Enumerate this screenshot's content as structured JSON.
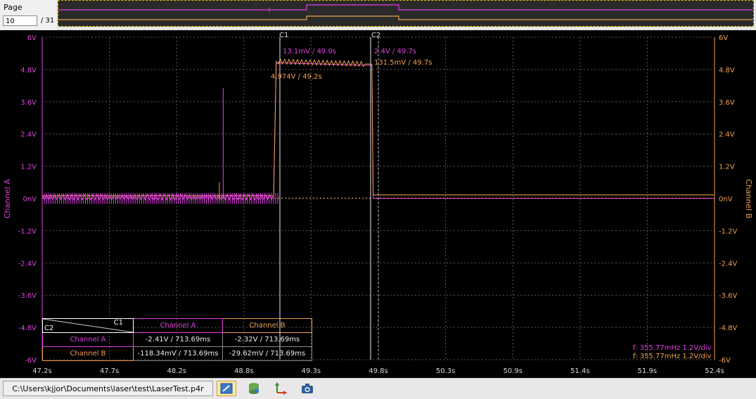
{
  "page": {
    "label": "Page",
    "current": "10",
    "total": "/ 31"
  },
  "colors": {
    "channel_a": "#e040e0",
    "channel_b": "#f0a050",
    "grid": "#5a5a5a",
    "background": "#000000"
  },
  "cursors": {
    "c1_label": "C1",
    "c2_label": "C2"
  },
  "annotations": {
    "c1_top": "13.1mV / 49.0s",
    "c1_mid": "4.974V / 49.2s",
    "c2_a": "2.4V / 49.7s",
    "c2_b": "131.5mV / 49.7s"
  },
  "axes": {
    "left_label": "Channel A",
    "right_label": "Channel B",
    "y_ticks": [
      "6V",
      "4.8V",
      "3.6V",
      "2.4V",
      "1.2V",
      "0nV",
      "-1.2V",
      "-2.4V",
      "-3.6V",
      "-4.8V",
      "-6V"
    ],
    "x_ticks": [
      "47.2s",
      "47.7s",
      "48.2s",
      "48.8s",
      "49.3s",
      "49.8s",
      "50.3s",
      "50.9s",
      "51.4s",
      "51.9s",
      "52.4s"
    ]
  },
  "measurement_table": {
    "corner_top": "C1",
    "corner_bottom": "C2",
    "headers": [
      "Channel A",
      "Channel B"
    ],
    "rows": [
      {
        "label": "Channel A",
        "cells": [
          "-2.41V / 713.69ms",
          "-2.32V / 713.69ms"
        ]
      },
      {
        "label": "Channel B",
        "cells": [
          "-118.34mV / 713.69ms",
          "-29.62mV / 713.69ms"
        ]
      }
    ]
  },
  "info": {
    "line_a": "f: 355.77mHz  1.2V/div",
    "line_b": "f: 355.77mHz  1.2V/div"
  },
  "chart_data": {
    "type": "line",
    "xlabel": "",
    "ylabel": "Channel A",
    "ylabel_right": "Channel B",
    "xlim": [
      47.2,
      52.4
    ],
    "ylim": [
      -6,
      6
    ],
    "grid": true,
    "series": [
      {
        "name": "Channel A",
        "x": [
          47.2,
          48.99,
          49.01,
          49.75,
          49.76,
          52.4
        ],
        "y": [
          0.0,
          0.0,
          5.05,
          4.95,
          0.0,
          0.0
        ]
      },
      {
        "name": "Channel B",
        "x": [
          47.2,
          48.99,
          49.01,
          49.75,
          49.76,
          52.4
        ],
        "y": [
          0.1,
          0.1,
          5.1,
          5.0,
          0.13,
          0.13
        ]
      }
    ],
    "cursors": [
      {
        "name": "C1",
        "x": 49.0
      },
      {
        "name": "C2",
        "x": 49.7
      }
    ]
  },
  "statusbar": {
    "filepath": "C:\\Users\\kjjor\\Documents\\laser\\test\\LaserTest.p4r"
  },
  "toolbar": {
    "icons": [
      "note-edit-icon",
      "database-icon",
      "axes-icon",
      "camera-icon"
    ]
  }
}
